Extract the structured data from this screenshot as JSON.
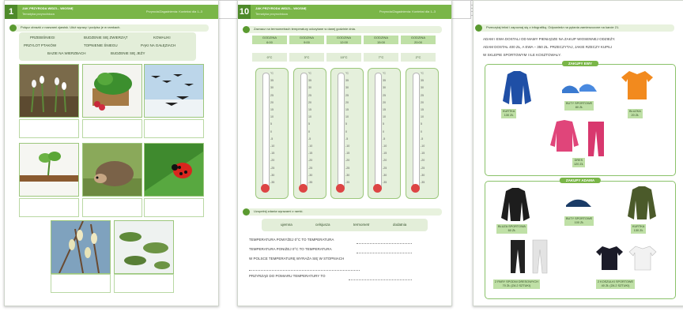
{
  "page1": {
    "header": {
      "num": "1",
      "t1": "JAK PRZYRODA WIDZI... WIOSNĘ",
      "t2": "Tematyka przyrodnicza",
      "t3": "Przyroda/Zagadnienia: Kontekst dla 1–3"
    },
    "task": "Połącz obrazki z nazwami zjawisk. Ułóż wyrazy i podpisz je w ramkach.",
    "words": [
      "PRZEBIŚNIEGI",
      "BUDZENIE SIĘ ZWIERZĄT",
      "KOWALIKI",
      "PRZYLOT PTAKÓW",
      "TOPNIENIE ŚNIEGU",
      "PĄKI NA GAŁĘZIACH",
      "BAZIE NA WIERZBACH",
      "BUDZENIE SIĘ JEŻY"
    ]
  },
  "page2": {
    "header": {
      "num": "10",
      "t1": "JAK PRZYRODA WIDZI... WIOSNĘ",
      "t2": "Tematyka przyrodnicza",
      "t3": "Przyroda/Zagadnienia: Kontekst dla 1–3"
    },
    "task1": "Zaznacz na termometrach temperatury odczytane w danej godzinie dnia.",
    "table": {
      "label": "GODZINA",
      "times": [
        "6:00",
        "9:00",
        "12:00",
        "15:00",
        "20:00"
      ],
      "temps": [
        "0°C",
        "3°C",
        "10°C",
        "7°C",
        "2°C"
      ]
    },
    "scale": [
      "°C",
      "35",
      "30",
      "25",
      "20",
      "15",
      "10",
      "5",
      "0",
      "-5",
      "-10",
      "-15",
      "-20",
      "-25",
      "-30",
      "-35"
    ],
    "task2": "Uzupełnij zdania wyrazami z ramki.",
    "chips": [
      "ujemna",
      "celsjusza",
      "termometr",
      "dodatnia"
    ],
    "statements": [
      "TEMPERATURA POWYŻEJ 0°C TO TEMPERATURA",
      "TEMPERATURA PONIŻEJ 0°C TO TEMPERATURA",
      "W POLSCE TEMPERATURĘ WYRAŻA SIĘ W STOPNIACH",
      "PRZYRZĄD DO POMIARU TEMPERATURY TO"
    ]
  },
  "page3": {
    "task": "Przeczytaj tekst i zapoznaj się z infografiką. Odpowiedz na pytania zamieszczone na karcie 21.",
    "statement": [
      "ADAM I EWA DOSTALI OD MAMY PIENIĄDZE NA ZAKUP WIOSENNEJ ODZIEŻY.",
      "ADAM DOSTAŁ 400 ZŁ, A EWA – 350 ZŁ. PRZECZYTAJ, JAKIE RZECZY KUPILI",
      "W SKLEPIE SPORTOWYM I ILE KOSZTOWAŁY."
    ],
    "ewa": {
      "title": "ZAKUPY EWY",
      "items": [
        {
          "name": "KURTKA",
          "price": "130 ZŁ"
        },
        {
          "name": "BUTY SPORTOWE",
          "price": "80 ZŁ"
        },
        {
          "name": "BLUZKA",
          "price": "20 ZŁ"
        },
        {
          "name": "DRES",
          "price": "120 ZŁ"
        }
      ]
    },
    "adam": {
      "title": "ZAKUPY ADAMA",
      "items": [
        {
          "name": "BLUZA SPORTOWA",
          "price": "60 ZŁ"
        },
        {
          "name": "BUTY SPORTOWE",
          "price": "100 ZŁ"
        },
        {
          "name": "KURTKA",
          "price": "130 ZŁ"
        },
        {
          "name": "2 PARY SPODNI DRESOWYCH",
          "price": "70 ZŁ (ZA 2 SZTUKI)"
        },
        {
          "name": "2 KOSZULKI SPORTOWE",
          "price": "40 ZŁ (ZA 2 SZTUKI)"
        }
      ]
    }
  },
  "colors": {
    "accent": "#7ab648",
    "accent_dark": "#4e8a2a",
    "light": "#e3eed9"
  }
}
